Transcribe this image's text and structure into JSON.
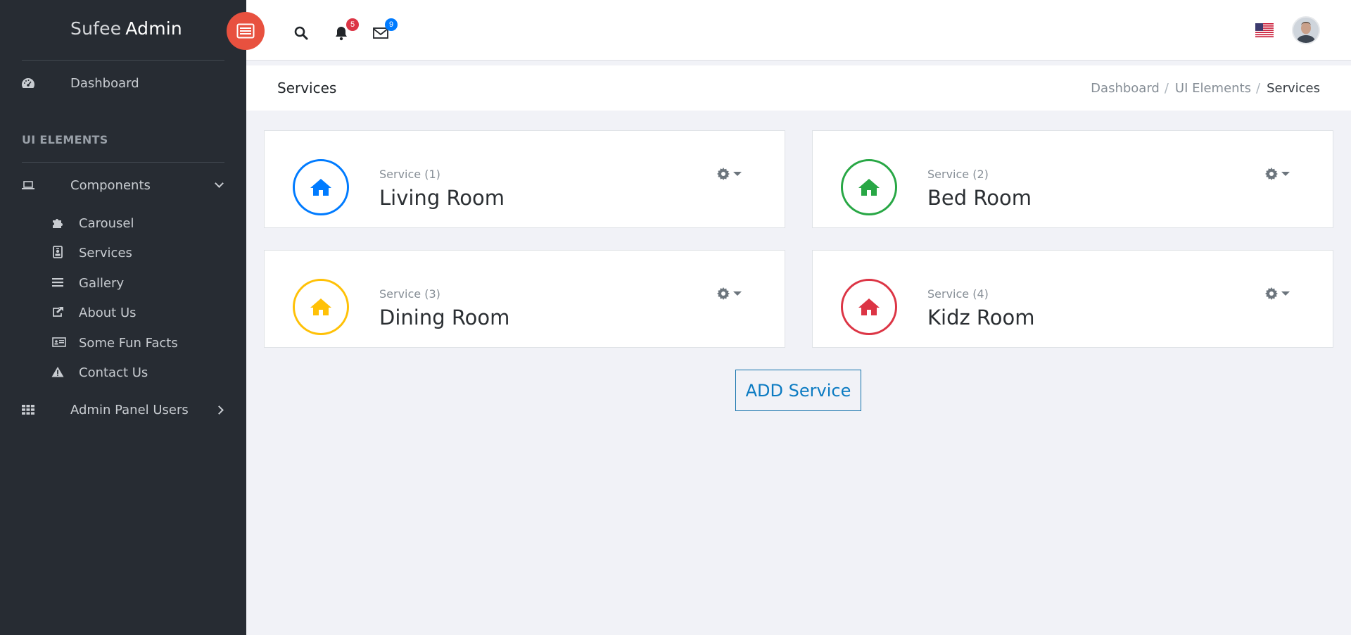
{
  "brand": {
    "light": "Sufee",
    "bold": "Admin"
  },
  "sidebar": {
    "dashboard": "Dashboard",
    "section_heading": "UI ELEMENTS",
    "components": "Components",
    "sub_items": [
      {
        "label": "Carousel",
        "icon": "puzzle-icon"
      },
      {
        "label": "Services",
        "icon": "id-badge-icon"
      },
      {
        "label": "Gallery",
        "icon": "bars-icon"
      },
      {
        "label": "About Us",
        "icon": "share-square-icon"
      },
      {
        "label": "Some Fun Facts",
        "icon": "id-card-icon"
      },
      {
        "label": "Contact Us",
        "icon": "warning-icon"
      }
    ],
    "admin_users": "Admin Panel Users"
  },
  "topbar": {
    "notifications_count": "5",
    "messages_count": "9",
    "notification_badge_color": "#dc3545",
    "message_badge_color": "#007bff"
  },
  "page": {
    "title": "Services",
    "breadcrumbs": [
      "Dashboard",
      "UI Elements",
      "Services"
    ]
  },
  "cards": [
    {
      "sub": "Service (1)",
      "title": "Living Room",
      "color": "#007bff"
    },
    {
      "sub": "Service (2)",
      "title": "Bed Room",
      "color": "#28a745"
    },
    {
      "sub": "Service (3)",
      "title": "Dining Room",
      "color": "#ffc107"
    },
    {
      "sub": "Service (4)",
      "title": "Kidz Room",
      "color": "#dc3545"
    }
  ],
  "add_button": "ADD Service",
  "colors": {
    "accent": "#e8513f",
    "sidebar_bg": "#272c33",
    "page_bg": "#f1f2f7"
  }
}
